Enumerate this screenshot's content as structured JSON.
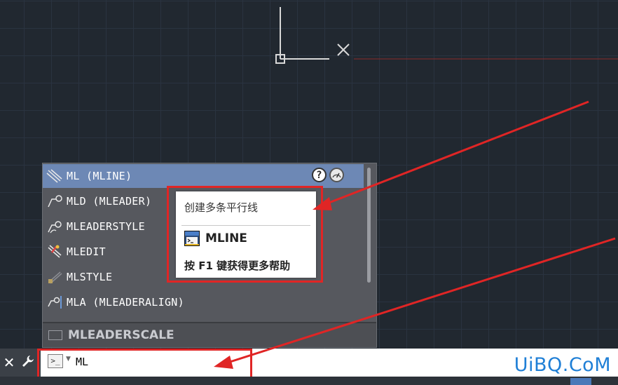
{
  "autocomplete": {
    "items": [
      {
        "label": "ML (MLINE)",
        "icon": "mline-icon",
        "selected": true
      },
      {
        "label": "MLD (MLEADER)",
        "icon": "mleader-icon"
      },
      {
        "label": "MLEADERSTYLE",
        "icon": "mleaderstyle-icon"
      },
      {
        "label": "MLEDIT",
        "icon": "mledit-icon"
      },
      {
        "label": "MLSTYLE",
        "icon": "mlstyle-icon"
      },
      {
        "label": "MLA (MLEADERALIGN)",
        "icon": "mleaderalign-icon"
      }
    ],
    "footer_label": "MLEADERSCALE",
    "help_glyph": "?"
  },
  "tooltip": {
    "description": "创建多条平行线",
    "command": "MLINE",
    "help_text": "按 F1 键获得更多帮助"
  },
  "command_line": {
    "close_glyph": "✕",
    "wrench_glyph": "🔧",
    "prompt_glyph": ">_",
    "dropdown_glyph": "▼",
    "input_value": "ML"
  },
  "watermark": "UiBQ.CoM",
  "colors": {
    "selection": "#6d88b5",
    "annotation_red": "#e02525",
    "watermark_blue": "#1f7fd6",
    "canvas_bg": "#212830"
  }
}
